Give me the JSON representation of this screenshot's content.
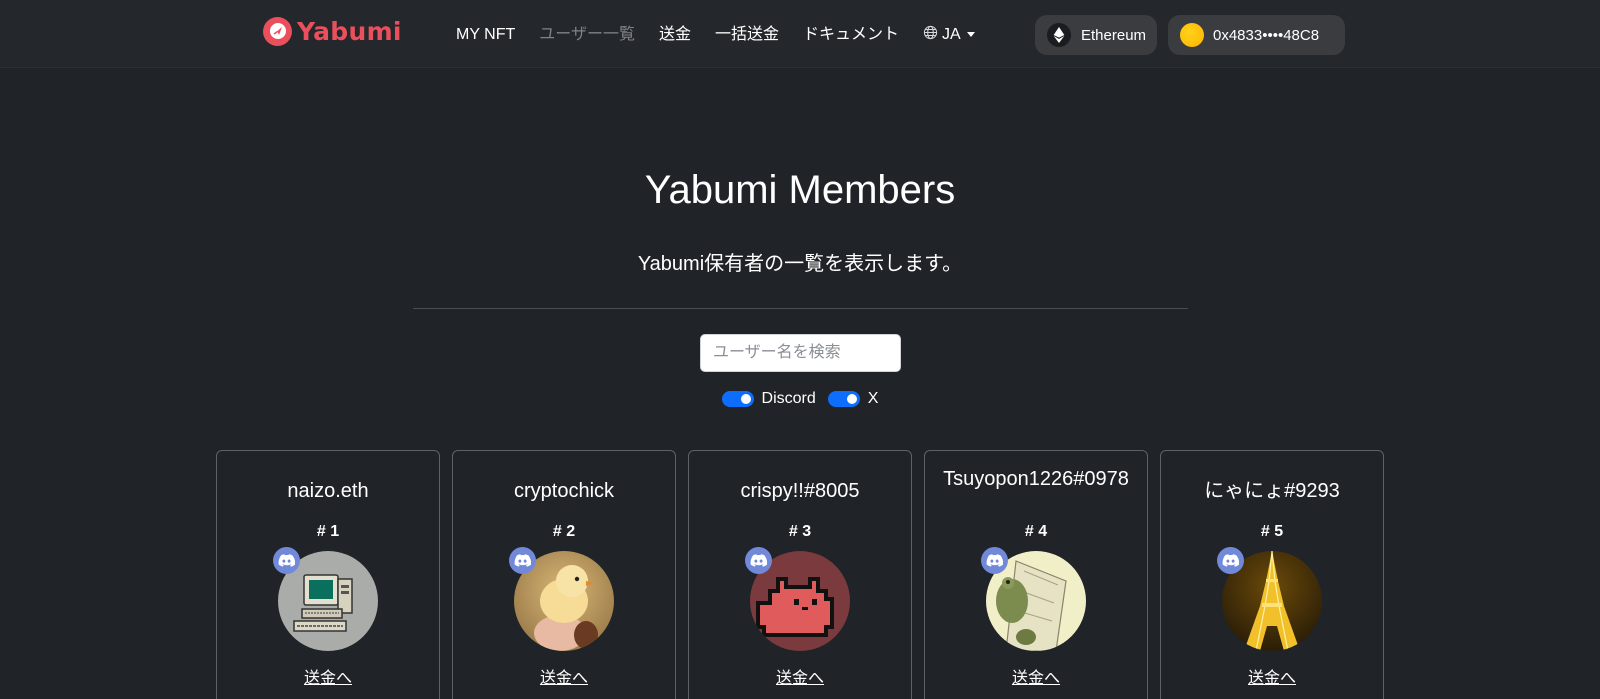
{
  "header": {
    "brand": "Yabumi",
    "nav": [
      {
        "label": "MY NFT",
        "active": false
      },
      {
        "label": "ユーザー一覧",
        "active": true
      },
      {
        "label": "送金",
        "active": false
      },
      {
        "label": "一括送金",
        "active": false
      },
      {
        "label": "ドキュメント",
        "active": false
      }
    ],
    "language": "JA",
    "language_icon": "globe-icon",
    "network": {
      "label": "Ethereum",
      "icon": "ethereum-icon"
    },
    "wallet": {
      "address": "0x4833••••48C8",
      "icon": "wallet-avatar-icon"
    }
  },
  "main": {
    "title": "Yabumi Members",
    "subtitle": "Yabumi保有者の一覧を表示します。",
    "search": {
      "placeholder": "ユーザー名を検索",
      "value": ""
    },
    "filters": [
      {
        "label": "Discord",
        "checked": true
      },
      {
        "label": "X",
        "checked": true
      }
    ]
  },
  "members": [
    {
      "name": "naizo.eth",
      "number": "# 1",
      "avatar": "computer-icon",
      "social": "discord-icon",
      "send_label": "送金へ"
    },
    {
      "name": "cryptochick",
      "number": "# 2",
      "avatar": "chick-icon",
      "social": "discord-icon",
      "send_label": "送金へ"
    },
    {
      "name": "crispy!!#8005",
      "number": "# 3",
      "avatar": "pixel-cat-icon",
      "social": "discord-icon",
      "send_label": "送金へ"
    },
    {
      "name": "Tsuyopon1226#0978",
      "number": "# 4",
      "avatar": "frog-icon",
      "social": "discord-icon",
      "send_label": "送金へ"
    },
    {
      "name": "にゃにょ#9293",
      "number": "# 5",
      "avatar": "eiffel-tower-icon",
      "social": "discord-icon",
      "send_label": "送金へ"
    }
  ],
  "colors": {
    "background": "#202327",
    "navbar": "#24272b",
    "brand": "#ea4f5b",
    "discord": "#7289da",
    "toggle": "#0d6efd"
  }
}
